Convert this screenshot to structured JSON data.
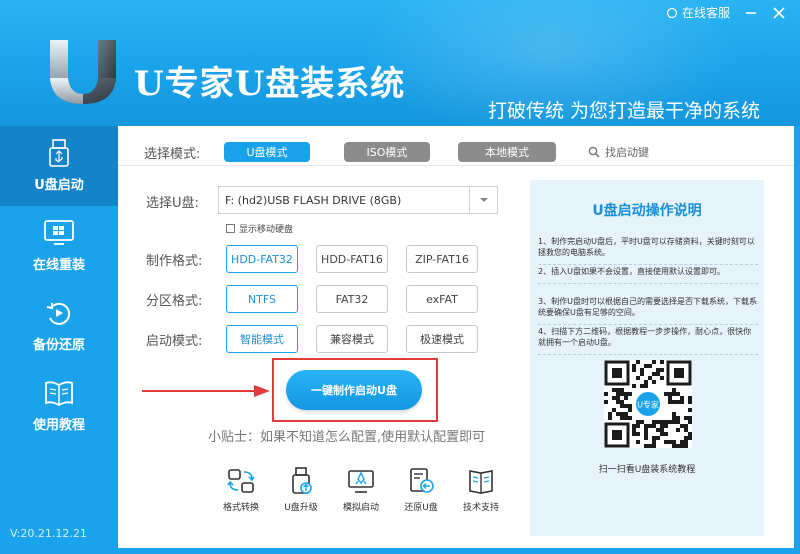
{
  "header": {
    "app_title": "U专家U盘装系统",
    "slogan": "打破传统 为您打造最干净的系统",
    "support_label": "在线客服"
  },
  "sidebar": {
    "items": [
      {
        "label": "U盘启动",
        "icon": "usb-drive-icon",
        "active": true
      },
      {
        "label": "在线重装",
        "icon": "windows-icon",
        "active": false
      },
      {
        "label": "备份还原",
        "icon": "restore-icon",
        "active": false
      },
      {
        "label": "使用教程",
        "icon": "book-icon",
        "active": false
      }
    ],
    "version": "V:20.21.12.21"
  },
  "mode": {
    "label": "选择模式:",
    "tabs": [
      "U盘模式",
      "ISO模式",
      "本地模式"
    ],
    "active": "U盘模式",
    "find_key": "找启动键"
  },
  "usb": {
    "label": "选择U盘:",
    "selected": "F: (hd2)USB FLASH DRIVE (8GB)",
    "show_mobile_disk": "显示移动硬盘"
  },
  "format": {
    "label": "制作格式:",
    "options": [
      "HDD-FAT32",
      "HDD-FAT16",
      "ZIP-FAT16"
    ],
    "selected": "HDD-FAT32"
  },
  "partition": {
    "label": "分区格式:",
    "options": [
      "NTFS",
      "FAT32",
      "exFAT"
    ],
    "selected": "NTFS"
  },
  "boot": {
    "label": "启动模式:",
    "options": [
      "智能模式",
      "兼容模式",
      "极速模式"
    ],
    "selected": "智能模式"
  },
  "make_button": "一键制作启动U盘",
  "tip": "小贴士：如果不知道怎么配置,使用默认配置即可",
  "tools": [
    {
      "label": "格式转换",
      "icon": "format-convert-icon"
    },
    {
      "label": "U盘升级",
      "icon": "usb-upgrade-icon"
    },
    {
      "label": "模拟启动",
      "icon": "simulate-boot-icon"
    },
    {
      "label": "还原U盘",
      "icon": "restore-usb-icon"
    },
    {
      "label": "技术支持",
      "icon": "tech-support-icon"
    }
  ],
  "instructions": {
    "title": "U盘启动操作说明",
    "steps": [
      "1、制作完启动U盘后，平时U盘可以存储资料，关键时刻可以拯救您的电脑系统。",
      "2、插入U盘如果不会设置，直接使用默认设置即可。",
      "3、制作U盘时可以根据自己的需要选择是否下载系统，下载系统要确保U盘有足够的空间。",
      "4、扫描下方二维码，根据教程一步步操作，耐心点，很快你就拥有一个启动U盘。"
    ],
    "qr_caption": "扫一扫看U盘装系统教程",
    "qr_center": "U专家"
  },
  "colors": {
    "accent": "#1aa3ea",
    "sidebar_active": "#1583c8",
    "highlight_red": "#e23b3b"
  }
}
